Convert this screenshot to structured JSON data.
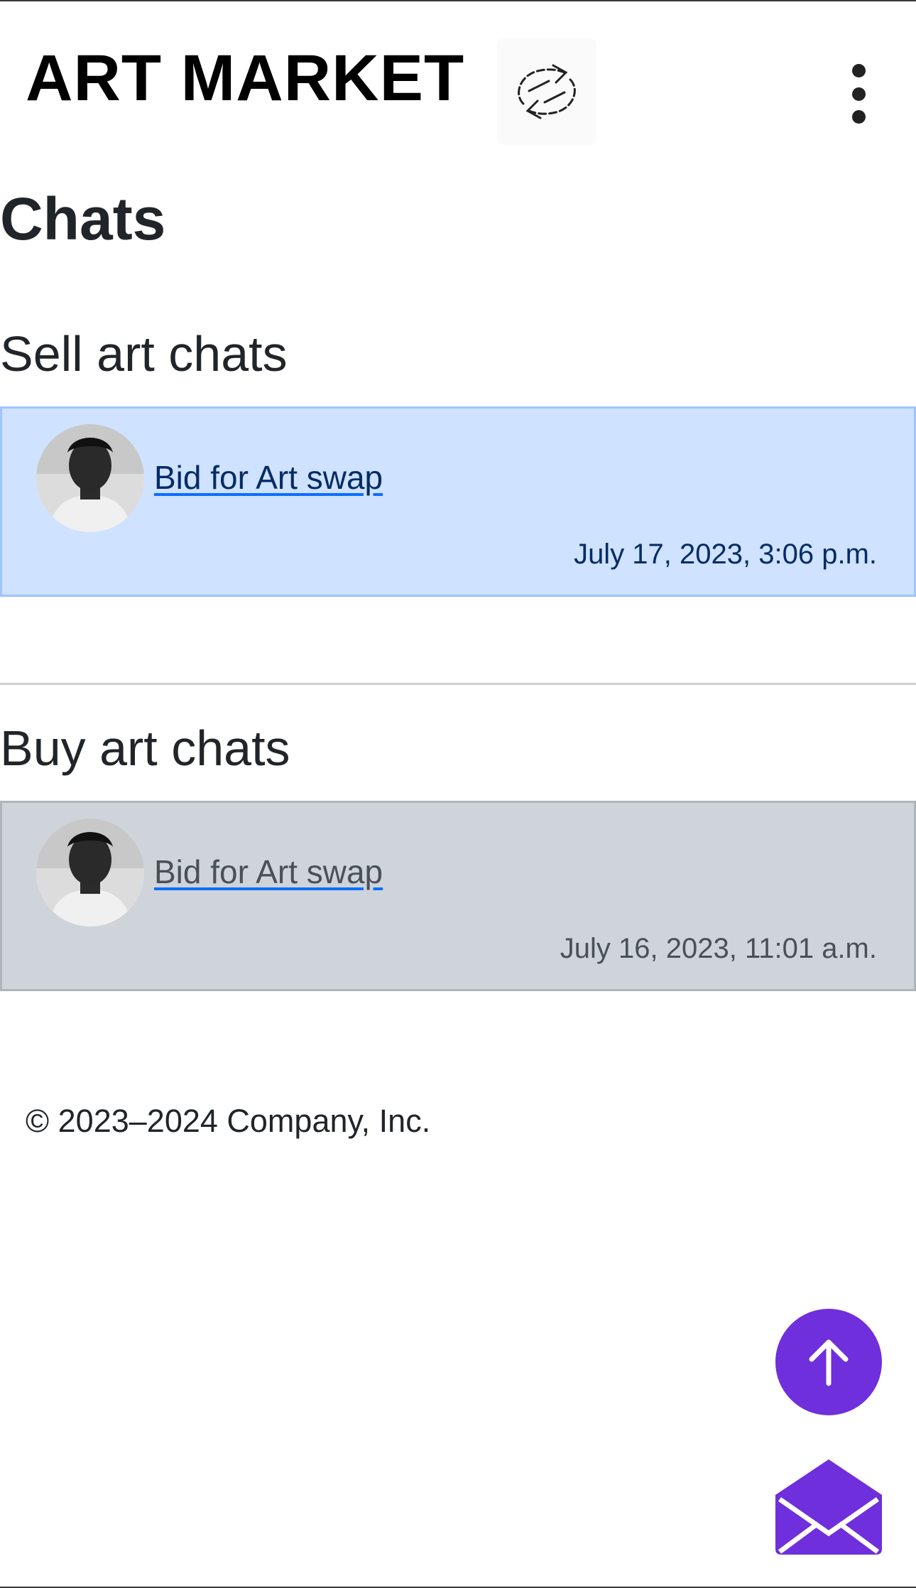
{
  "header": {
    "brand": "ART MARKET",
    "logo_icon": "swap-arrows-icon",
    "menu_icon": "kebab-menu-icon"
  },
  "page": {
    "title": "Chats"
  },
  "sell_section": {
    "title": "Sell art chats",
    "chats": [
      {
        "link_text": "Bid for Art swap",
        "timestamp": "July 17, 2023, 3:06 p.m."
      }
    ]
  },
  "buy_section": {
    "title": "Buy art chats",
    "chats": [
      {
        "link_text": "Bid for Art swap",
        "timestamp": "July 16, 2023, 11:01 a.m."
      }
    ]
  },
  "footer": {
    "copyright": "© 2023–2024 Company, Inc."
  },
  "floating_buttons": {
    "scroll_top_icon": "arrow-up-icon",
    "messages_icon": "envelope-open-icon"
  },
  "colors": {
    "sell_card_bg": "#cfe2ff",
    "buy_card_bg": "#ced4da",
    "fab_purple": "#6f2fdc",
    "link_underline": "#0d6efd"
  }
}
